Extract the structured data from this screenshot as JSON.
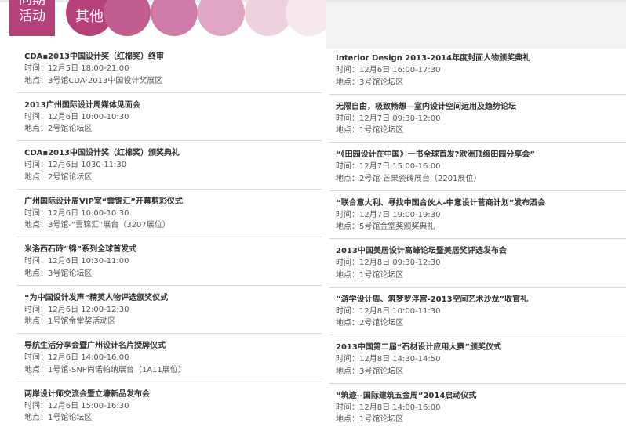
{
  "tabs": {
    "active_label": "同期\n活动",
    "other_label": "其他"
  },
  "left_events": [
    {
      "title": "CDA▪2013中国设计奖（红棉奖）终审",
      "time": "时间：12月5日 18:00-21:00",
      "place": "地点：3号馆CDA·2013中国设计奖展区"
    },
    {
      "title": "2013广州国际设计周媒体见面会",
      "time": "时间：12月6日 10:00-10:30",
      "place": "地点：2号馆论坛区"
    },
    {
      "title": "CDA▪2013中国设计奖（红棉奖）颁奖典礼",
      "time": "时间：12月6日 1030-11:30",
      "place": "地点：2号馆论坛区"
    },
    {
      "title": "广州国际设计周VIP室“雲锦汇”开幕剪彩仪式",
      "time": "时间：12月6日 10:00-10:30",
      "place": "地点：3号馆-“雲锦汇”展台（3207展位）"
    },
    {
      "title": "米洛西石砖“锦”系列全球首发式",
      "time": "时间：12月6日 10:30-11:00",
      "place": "地点：3号馆论坛区"
    },
    {
      "title": "“为中国设计发声”精英人物评选颁奖仪式",
      "time": "时间：12月6日 12:00-12:30",
      "place": "地点：1号馆金堂奖活动区"
    },
    {
      "title": "导航生活分享会暨广州设计名片授牌仪式",
      "time": "时间：12月6日 14:00-16:00",
      "place": "地点：1号馆-SNP尚诺帕纳展台（1A11展位）"
    },
    {
      "title": "两岸设计师交流会暨立壕新品发布会",
      "time": "时间：12月6日 15:00-16:30",
      "place": "地点：1号馆论坛区"
    }
  ],
  "right_events": [
    {
      "title": "Interior Design 2013-2014年度封面人物颁奖典礼",
      "time": "时间：12月6日 16:00-17:30",
      "place": "地点：3号馆论坛区"
    },
    {
      "title": "无限自由，极致畅想—室内设计空间运用及趋势论坛",
      "time": "时间：12月7日 09:30-12:00",
      "place": "地点：1号馆论坛区"
    },
    {
      "title": "“《田园设计在中国》一书全球首发?欧洲顶级田园分享会”",
      "time": "时间：12月7日 15:00-16:00",
      "place": "地点：2号馆-芒果瓷砖展台（2201展位）"
    },
    {
      "title": "“联合意大利、寻找中国合伙人-中意设计营商计划”发布酒会",
      "time": "时间：12月7日 19:00-19:30",
      "place": "地点：5号馆金堂奖颁奖典礼"
    },
    {
      "title": "2013中国美居设计高峰论坛暨美居奖评选发布会",
      "time": "时间：12月8日 09:30-12:30",
      "place": "地点：1号馆论坛区"
    },
    {
      "title": "“游学设计周、筑梦罗浮宫-2013空间艺术沙龙”收官礼",
      "time": "时间：12月8日 10:00-11:30",
      "place": "地点：2号馆论坛区"
    },
    {
      "title": "2013中国第二届“石材设计应用大赛”颁奖仪式",
      "time": "时间：12月8日 14:30-14:50",
      "place": "地点：3号馆论坛区"
    },
    {
      "title": "“筑迹--国际建筑五金周”2014启动仪式",
      "time": "时间：12月8日 14:00-16:00",
      "place": "地点：1号馆论坛区"
    }
  ]
}
